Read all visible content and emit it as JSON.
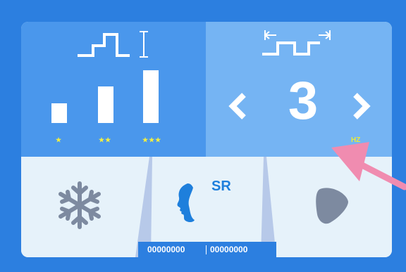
{
  "intensity": {
    "levels": [
      {
        "stars": "★"
      },
      {
        "stars": "★★"
      },
      {
        "stars": "★★★"
      }
    ]
  },
  "frequency": {
    "value": "3",
    "unit": "HZ"
  },
  "modes": {
    "left_icon": "snowflake-icon",
    "center_icon": "face-profile-icon",
    "center_label": "SR",
    "right_icon": "guitar-pick-shape-icon"
  },
  "counters": {
    "left": "00000000",
    "right": "00000000"
  },
  "colors": {
    "background": "#2c7fe0",
    "left_panel": "#4a97ec",
    "right_panel": "#75b4f3",
    "bottom_panel": "#e6f2fa",
    "stars": "#f4f040",
    "unit": "#e9e93a",
    "accent_blue": "#1e7fdc",
    "pointer_arrow": "#f08cb0"
  }
}
